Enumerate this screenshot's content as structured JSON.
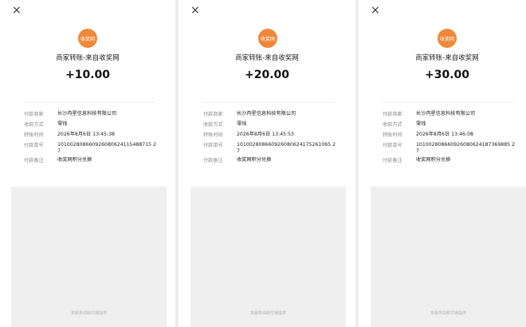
{
  "panels": [
    {
      "close_icon": "×",
      "logo_text": "收奖网",
      "title": "商家转账-来自收奖网",
      "amount": "+10.00",
      "rows": [
        {
          "label": "付款商家",
          "value": "长沙冉星信息科技有限公司"
        },
        {
          "label": "收款方式",
          "value": "零钱"
        },
        {
          "label": "转账时间",
          "value": "2026年8月6日 13:45:38"
        },
        {
          "label": "付款单号",
          "value": "101002808660926080624115488715 27"
        },
        {
          "label": "付款备注",
          "value": "收奖网积分兑换"
        }
      ],
      "ad_note": "本服务由财付通提供"
    },
    {
      "close_icon": "×",
      "logo_text": "收奖网",
      "title": "商家转账-来自收奖网",
      "amount": "+20.00",
      "rows": [
        {
          "label": "付款商家",
          "value": "长沙冉星信息科技有限公司"
        },
        {
          "label": "收款方式",
          "value": "零钱"
        },
        {
          "label": "转账时间",
          "value": "2026年8月6日 13:45:53"
        },
        {
          "label": "付款单号",
          "value": "101002808660926080624175261065 27"
        },
        {
          "label": "付款备注",
          "value": "收奖网积分兑换"
        }
      ],
      "ad_note": "本服务由财付通提供"
    },
    {
      "close_icon": "×",
      "logo_text": "收奖网",
      "title": "商家转账-来自收奖网",
      "amount": "+30.00",
      "rows": [
        {
          "label": "付款商家",
          "value": "长沙冉星信息科技有限公司"
        },
        {
          "label": "收款方式",
          "value": "零钱"
        },
        {
          "label": "转账时间",
          "value": "2026年8月6日 13:46:08"
        },
        {
          "label": "付款单号",
          "value": "101002808660926080624187369885 27"
        },
        {
          "label": "付款备注",
          "value": "收奖网积分兑换"
        }
      ],
      "ad_note": "本服务由财付通提供"
    }
  ],
  "colors": {
    "logo": "#f0883a",
    "background": "#ededed",
    "ad_box": "#efefef"
  }
}
